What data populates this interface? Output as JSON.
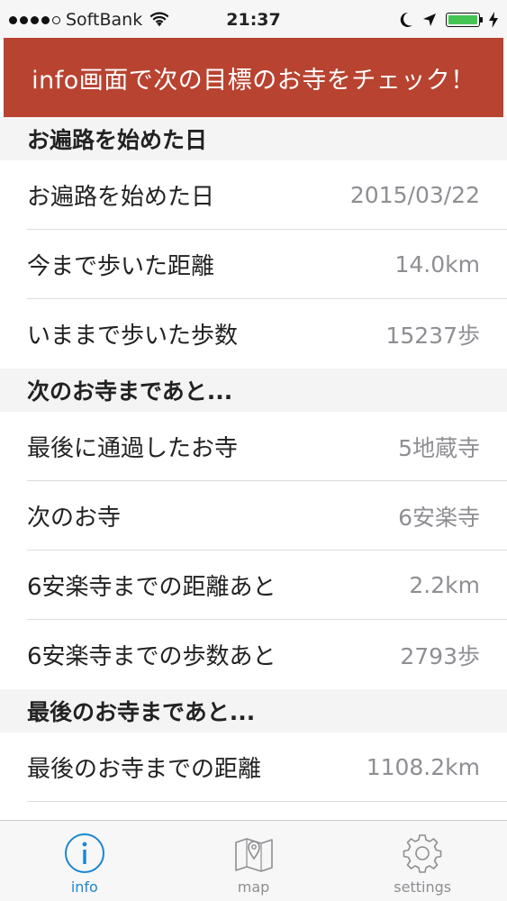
{
  "status_bar": {
    "carrier": "SoftBank",
    "time": "21:37",
    "battery_color": "#44c553"
  },
  "banner": {
    "text": "info画面で次の目標のお寺をチェック！",
    "color": "#b84330"
  },
  "sections": [
    {
      "header": "お遍路を始めた日",
      "rows": [
        {
          "label": "お遍路を始めた日",
          "value": "2015/03/22"
        },
        {
          "label": "今まで歩いた距離",
          "value": "14.0km"
        },
        {
          "label": "いままで歩いた歩数",
          "value": "15237歩"
        }
      ]
    },
    {
      "header": "次のお寺まであと...",
      "rows": [
        {
          "label": "最後に通過したお寺",
          "value": "5地蔵寺"
        },
        {
          "label": "次のお寺",
          "value": "6安楽寺"
        },
        {
          "label": "6安楽寺までの距離あと",
          "value": "2.2km"
        },
        {
          "label": "6安楽寺までの歩数あと",
          "value": "2793歩"
        }
      ]
    },
    {
      "header": "最後のお寺まであと...",
      "rows": [
        {
          "label": "最後のお寺までの距離",
          "value": "1108.2km"
        }
      ]
    }
  ],
  "tab_bar": {
    "tabs": [
      {
        "label": "info",
        "icon": "info-icon",
        "active": true
      },
      {
        "label": "map",
        "icon": "map-icon",
        "active": false
      },
      {
        "label": "settings",
        "icon": "gear-icon",
        "active": false
      }
    ],
    "active_color": "#1a86d0",
    "inactive_color": "#8e8e93"
  }
}
